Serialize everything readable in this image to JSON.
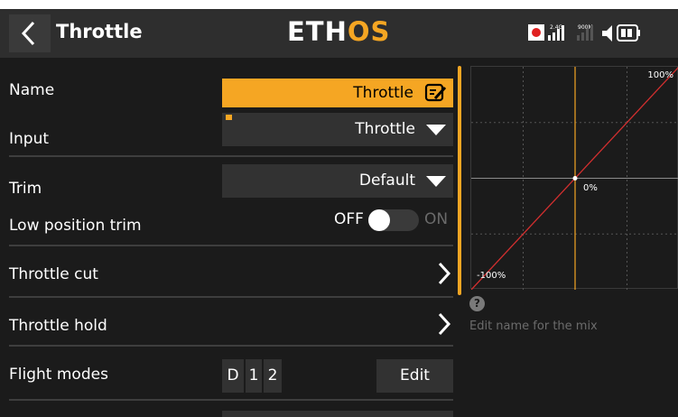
{
  "header": {
    "title": "Throttle",
    "logo_left": "ETH",
    "logo_right": "OS",
    "signal_label_1": "2.4G",
    "signal_label_2": "900M",
    "accent": "#f5a623"
  },
  "form": {
    "name": {
      "label": "Name",
      "value": "Throttle",
      "icon": "edit-icon"
    },
    "input": {
      "label": "Input",
      "value": "Throttle"
    },
    "trim": {
      "label": "Trim",
      "value": "Default"
    },
    "low_position_trim": {
      "label": "Low position trim",
      "off_label": "OFF",
      "on_label": "ON",
      "state": "off"
    },
    "throttle_cut": {
      "label": "Throttle cut",
      "icon": "chevron-right-icon"
    },
    "throttle_hold": {
      "label": "Throttle hold",
      "icon": "chevron-right-icon"
    },
    "flight_modes": {
      "label": "Flight modes",
      "modes": [
        "D",
        "1",
        "2"
      ],
      "edit_label": "Edit"
    }
  },
  "graph": {
    "label_max": "100%",
    "label_center": "0%",
    "label_min": "-100%",
    "curve": {
      "x": [
        -100,
        100
      ],
      "y": [
        -100,
        100
      ]
    },
    "point": {
      "x": 0,
      "y": 0
    },
    "line_color": "#d32f2f",
    "axis_color": "#f5a623"
  },
  "help": {
    "icon": "help-icon",
    "icon_text": "?",
    "text": "Edit name for the mix"
  }
}
